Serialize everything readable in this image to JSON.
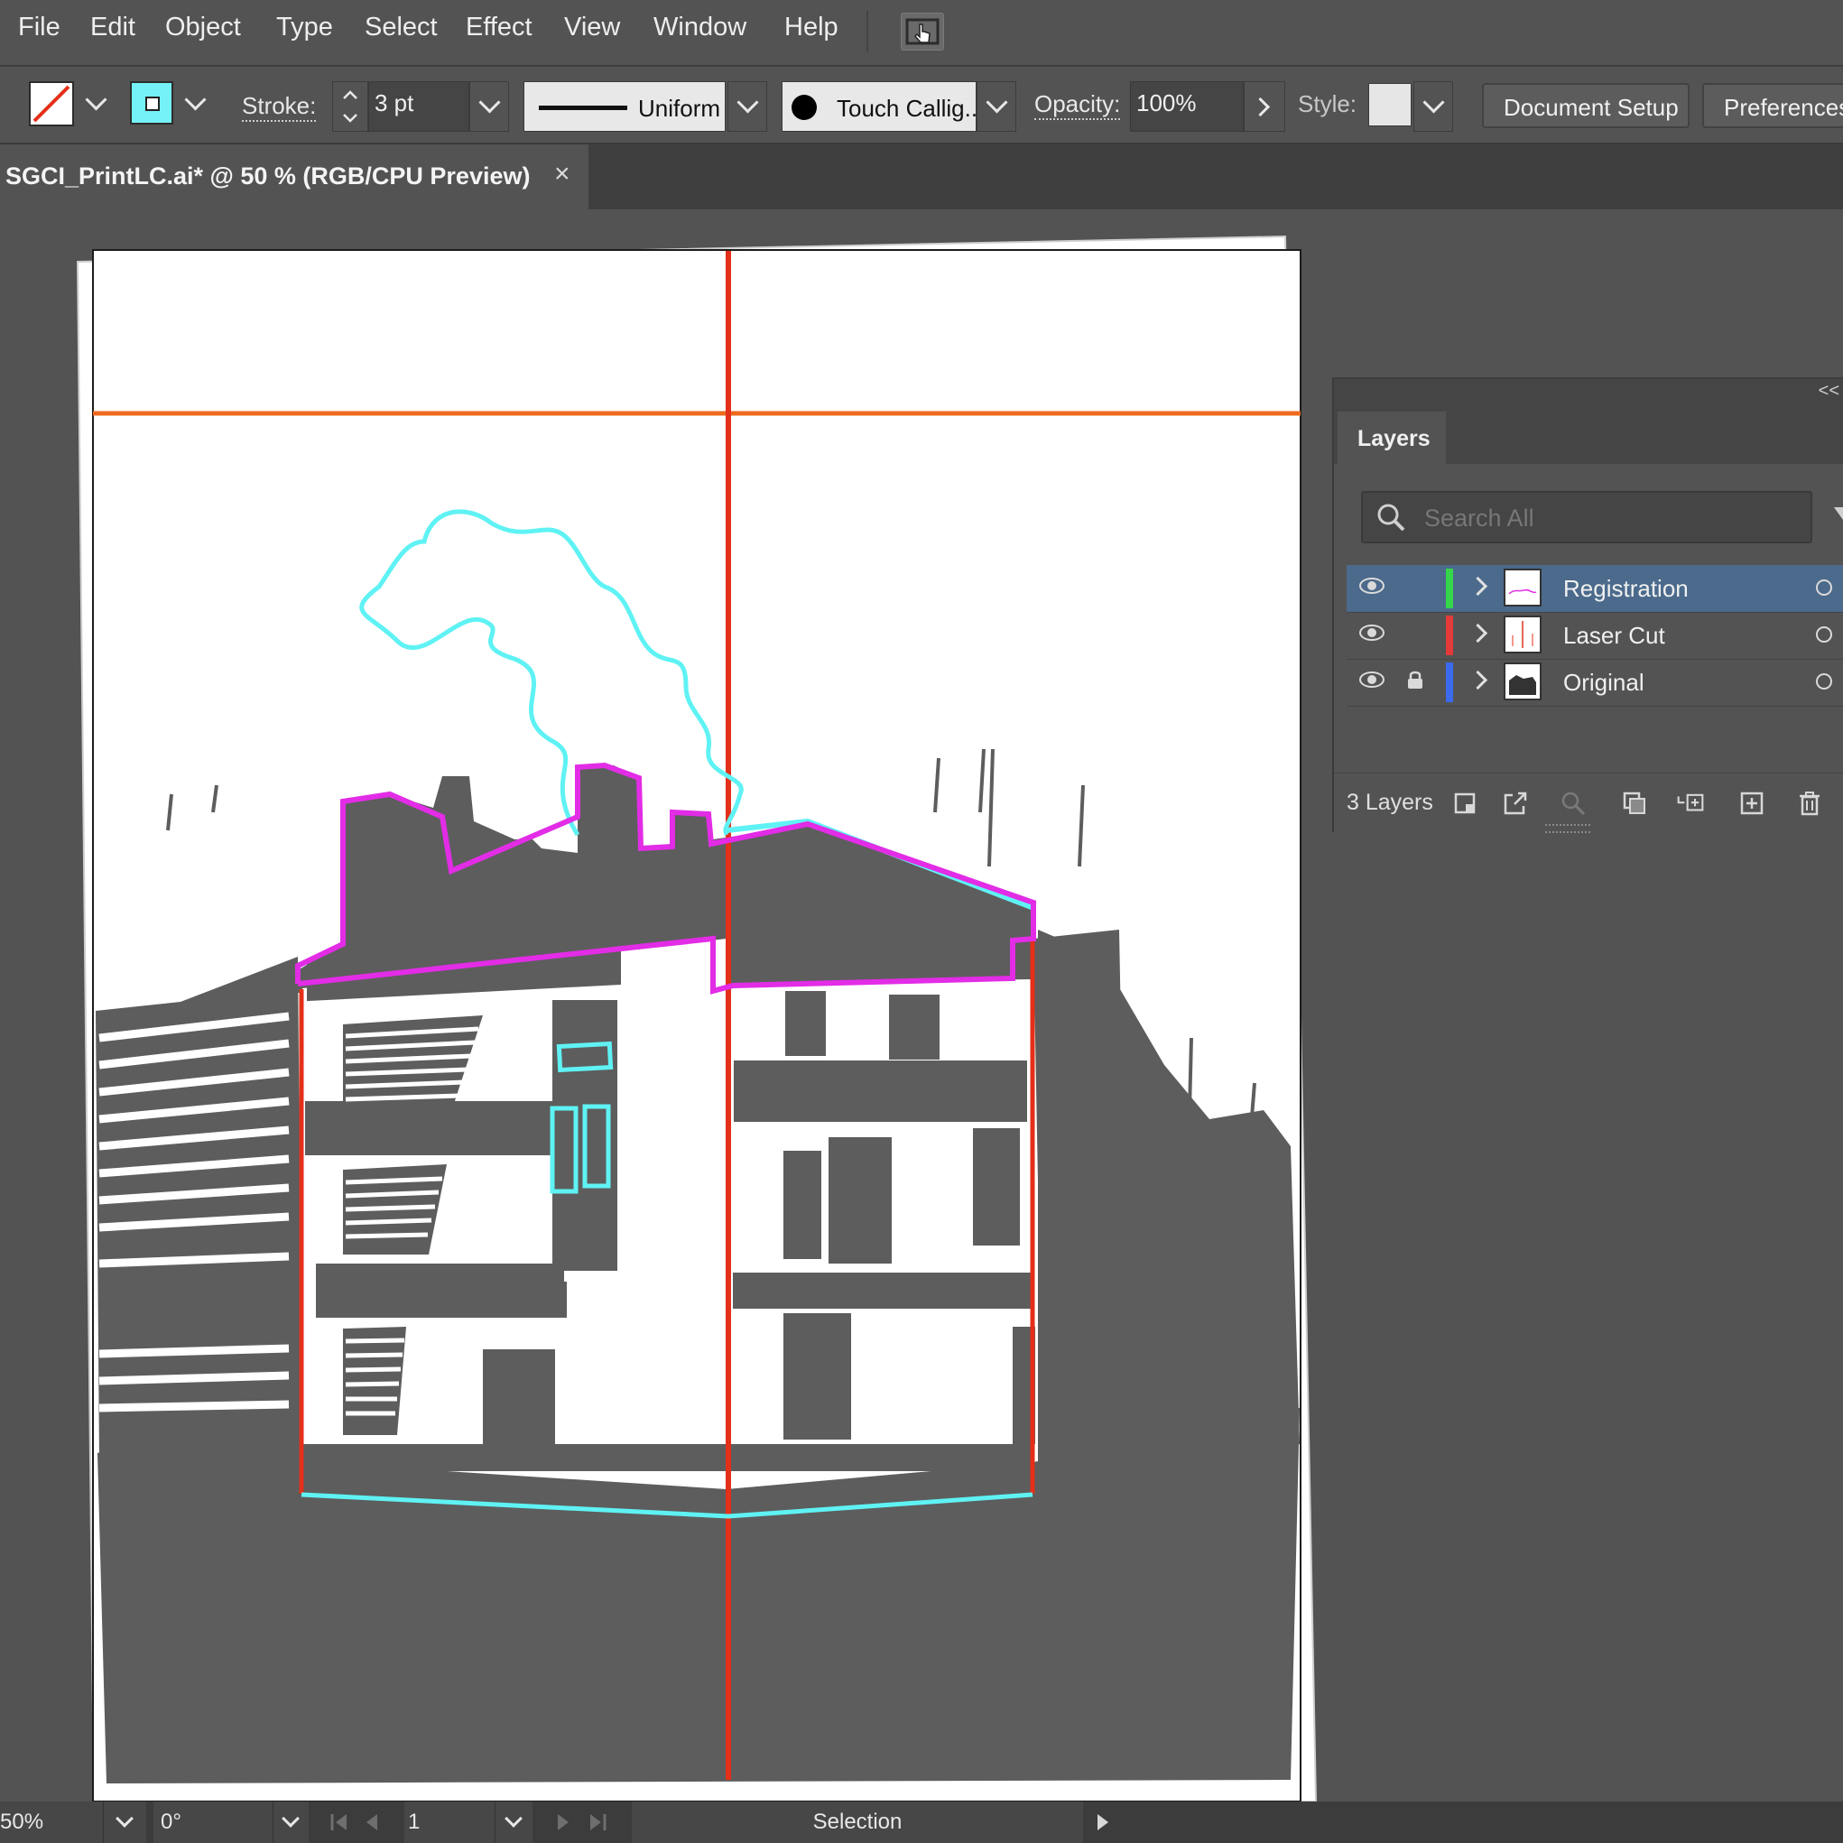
{
  "menubar": {
    "items": [
      "File",
      "Edit",
      "Object",
      "Type",
      "Select",
      "Effect",
      "View",
      "Window",
      "Help"
    ]
  },
  "controlbar": {
    "stroke_label": "Stroke:",
    "stroke_weight": "3 pt",
    "profile_label": "Uniform",
    "brush_label": "Touch Callig...",
    "opacity_label": "Opacity:",
    "opacity_value": "100%",
    "style_label": "Style:",
    "document_setup": "Document Setup",
    "preferences": "Preferences",
    "fill_color": "none",
    "stroke_color": "#74f2f7"
  },
  "document_tab": {
    "title": "SGCI_PrintLC.ai* @ 50 % (RGB/CPU Preview)",
    "close": "×"
  },
  "layers_panel": {
    "tab_label": "Layers",
    "collapse": "<<",
    "search_placeholder": "Search All",
    "layers": [
      {
        "name": "Registration",
        "color": "#35d64a",
        "locked": false,
        "selected": true
      },
      {
        "name": "Laser Cut",
        "color": "#e43a3a",
        "locked": false,
        "selected": false
      },
      {
        "name": "Original",
        "color": "#3a6bef",
        "locked": true,
        "selected": false
      }
    ],
    "footer_count": "3 Layers"
  },
  "statusbar": {
    "zoom": "50%",
    "rotation": "0°",
    "page": "1",
    "tool": "Selection"
  },
  "colors": {
    "registration_magenta": "#e22ce6",
    "cyan_path": "#5ff2f4",
    "red_cut": "#e3301a",
    "orange_guide": "#ee6a1e",
    "print_ink": "#5d5d5d"
  }
}
